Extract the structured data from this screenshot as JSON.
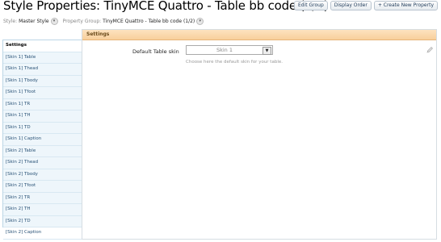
{
  "header": {
    "title": "Style Properties: TinyMCE Quattro - Table bb code (1/2)",
    "buttons": [
      "Edit Group",
      "Display Order",
      "+ Create New Property"
    ]
  },
  "crumbs": {
    "style_label": "Style:",
    "style_value": "Master Style",
    "group_label": "Property Group:",
    "group_value": "TinyMCE Quattro - Table bb code (1/2)"
  },
  "sidebar": {
    "items": [
      "Settings",
      "[Skin 1] Table",
      "[Skin 1] Thead",
      "[Skin 1] Tbody",
      "[Skin 1] Tfoot",
      "[Skin 1] TR",
      "[Skin 1] TH",
      "[Skin 1] TD",
      "[Skin 1] Caption",
      "[Skin 2] Table",
      "[Skin 2] Thead",
      "[Skin 2] Tbody",
      "[Skin 2] Tfoot",
      "[Skin 2] TR",
      "[Skin 2] TH",
      "[Skin 2] TD",
      "[Skin 2] Caption"
    ]
  },
  "main": {
    "heading": "Settings",
    "field_label": "Default Table skin",
    "select_value": "Skin 1",
    "hint": "Choose here the default skin for your table."
  }
}
